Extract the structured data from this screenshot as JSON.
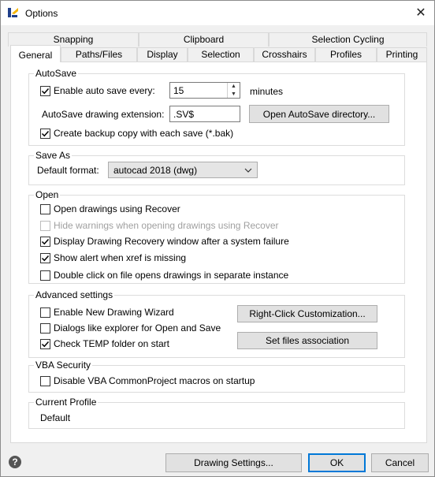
{
  "window": {
    "title": "Options",
    "close_glyph": "✕",
    "app_icon": "app-logo-icon"
  },
  "tabs_row1": [
    {
      "label": "Snapping"
    },
    {
      "label": "Clipboard"
    },
    {
      "label": "Selection Cycling"
    }
  ],
  "tabs_row2": [
    {
      "label": "General",
      "active": true
    },
    {
      "label": "Paths/Files"
    },
    {
      "label": "Display"
    },
    {
      "label": "Selection"
    },
    {
      "label": "Crosshairs"
    },
    {
      "label": "Profiles"
    },
    {
      "label": "Printing"
    }
  ],
  "autosave": {
    "group_label": "AutoSave",
    "enable_label": "Enable auto save every:",
    "enable_checked": true,
    "interval_value": "15",
    "interval_unit": "minutes",
    "extension_label": "AutoSave drawing extension:",
    "extension_value": ".SV$",
    "open_dir_button": "Open AutoSave directory...",
    "backup_label": "Create backup copy with each save (*.bak)",
    "backup_checked": true
  },
  "save_as": {
    "group_label": "Save As",
    "format_label": "Default format:",
    "format_value": "autocad 2018 (dwg)"
  },
  "open": {
    "group_label": "Open",
    "items": [
      {
        "label": "Open drawings using Recover",
        "checked": false,
        "disabled": false
      },
      {
        "label": "Hide warnings when opening drawings using Recover",
        "checked": false,
        "disabled": true
      },
      {
        "label": "Display Drawing Recovery window after a system failure",
        "checked": true,
        "disabled": false
      },
      {
        "label": "Show alert when xref is missing",
        "checked": true,
        "disabled": false
      },
      {
        "label": "Double click on file opens drawings in separate instance",
        "checked": false,
        "disabled": false
      }
    ]
  },
  "advanced": {
    "group_label": "Advanced settings",
    "items": [
      {
        "label": "Enable New Drawing Wizard",
        "checked": false
      },
      {
        "label": "Dialogs like explorer for Open and Save",
        "checked": false
      },
      {
        "label": "Check TEMP folder on start",
        "checked": true
      }
    ],
    "right_click_button": "Right-Click Customization...",
    "file_assoc_button": "Set files association"
  },
  "vba": {
    "group_label": "VBA Security",
    "disable_label": "Disable VBA CommonProject macros on startup",
    "disable_checked": false
  },
  "profile": {
    "group_label": "Current Profile",
    "value": "Default"
  },
  "footer": {
    "help_glyph": "?",
    "drawing_settings": "Drawing Settings...",
    "ok": "OK",
    "cancel": "Cancel"
  },
  "colors": {
    "accent": "#0078d7",
    "panel_bg": "#ffffff",
    "dialog_bg": "#f0f0f0"
  }
}
